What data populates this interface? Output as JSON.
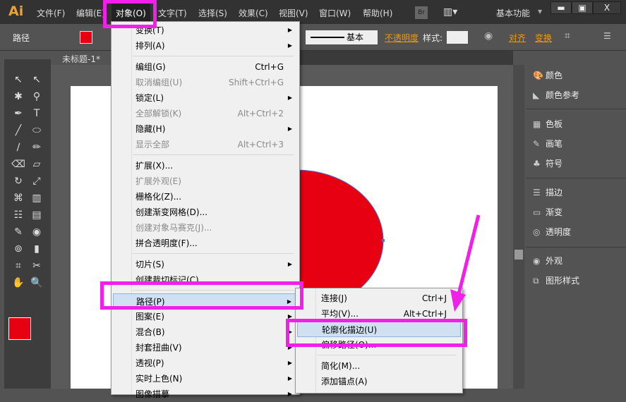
{
  "app": {
    "logo": "Ai",
    "menus": [
      "文件(F)",
      "编辑(E)",
      "对象(O)",
      "文字(T)",
      "选择(S)",
      "效果(C)",
      "视图(V)",
      "窗口(W)",
      "帮助(H)"
    ],
    "bridge": "Br",
    "workspace": "基本功能",
    "window_buttons": [
      "▬",
      "▣",
      "X"
    ]
  },
  "control": {
    "selection": "路径",
    "stroke_style": "基本",
    "opacity": "不透明度",
    "style": "样式:",
    "align": "对齐",
    "transform": "变换"
  },
  "document": {
    "tab": "未标题-1* @",
    "fill_color": "#e60012"
  },
  "object_menu": [
    {
      "label": "变换(T)",
      "sub": true
    },
    {
      "label": "排列(A)",
      "sub": true
    },
    {
      "sep": true
    },
    {
      "label": "编组(G)",
      "shortcut": "Ctrl+G"
    },
    {
      "label": "取消编组(U)",
      "shortcut": "Shift+Ctrl+G",
      "disabled": true
    },
    {
      "label": "锁定(L)",
      "sub": true
    },
    {
      "label": "全部解锁(K)",
      "shortcut": "Alt+Ctrl+2",
      "disabled": true
    },
    {
      "label": "隐藏(H)",
      "sub": true
    },
    {
      "label": "显示全部",
      "shortcut": "Alt+Ctrl+3",
      "disabled": true
    },
    {
      "sep": true
    },
    {
      "label": "扩展(X)..."
    },
    {
      "label": "扩展外观(E)",
      "disabled": true
    },
    {
      "label": "栅格化(Z)..."
    },
    {
      "label": "创建渐变网格(D)..."
    },
    {
      "label": "创建对象马赛克(J)...",
      "disabled": true
    },
    {
      "label": "拼合透明度(F)..."
    },
    {
      "sep": true
    },
    {
      "label": "切片(S)",
      "sub": true
    },
    {
      "label": "创建裁切标记(C)"
    },
    {
      "sep": true
    },
    {
      "label": "路径(P)",
      "sub": true,
      "highlighted": true
    },
    {
      "label": "图案(E)",
      "sub": true
    },
    {
      "label": "混合(B)",
      "sub": true
    },
    {
      "label": "封套扭曲(V)",
      "sub": true
    },
    {
      "label": "透视(P)",
      "sub": true
    },
    {
      "label": "实时上色(N)",
      "sub": true
    },
    {
      "label": "图像描摹",
      "sub": true
    }
  ],
  "path_submenu": [
    {
      "label": "连接(J)",
      "shortcut": "Ctrl+J"
    },
    {
      "label": "平均(V)...",
      "shortcut": "Alt+Ctrl+J"
    },
    {
      "label": "轮廓化描边(U)",
      "highlighted": true
    },
    {
      "label": "偏移路径(O)..."
    },
    {
      "sep": true
    },
    {
      "label": "简化(M)..."
    },
    {
      "label": "添加锚点(A)"
    }
  ],
  "right_panel": [
    {
      "icon": "palette-icon",
      "glyph": "🎨",
      "label": "颜色"
    },
    {
      "icon": "color-guide-icon",
      "glyph": "◣",
      "label": "颜色参考"
    },
    {
      "icon": "swatches-icon",
      "glyph": "▦",
      "label": "色板"
    },
    {
      "icon": "brush-icon",
      "glyph": "✎",
      "label": "画笔"
    },
    {
      "icon": "symbol-icon",
      "glyph": "♣",
      "label": "符号"
    },
    {
      "icon": "stroke-icon",
      "glyph": "☰",
      "label": "描边"
    },
    {
      "icon": "gradient-icon",
      "glyph": "▭",
      "label": "渐变"
    },
    {
      "icon": "transparency-icon",
      "glyph": "◎",
      "label": "透明度"
    },
    {
      "icon": "appearance-icon",
      "glyph": "◉",
      "label": "外观"
    },
    {
      "icon": "graphic-styles-icon",
      "glyph": "⧉",
      "label": "图形样式"
    }
  ],
  "tools": [
    "↖",
    "↖",
    "✱",
    "⚲",
    "✒",
    "T",
    "╱",
    "⬭",
    "∕",
    "✏",
    "⌫",
    "▱",
    "↻",
    "⤢",
    "⌘",
    "▥",
    "☷",
    "▤",
    "✎",
    "◉",
    "⊚",
    "▮",
    "⌗",
    "✂",
    "✋",
    "🔍"
  ]
}
